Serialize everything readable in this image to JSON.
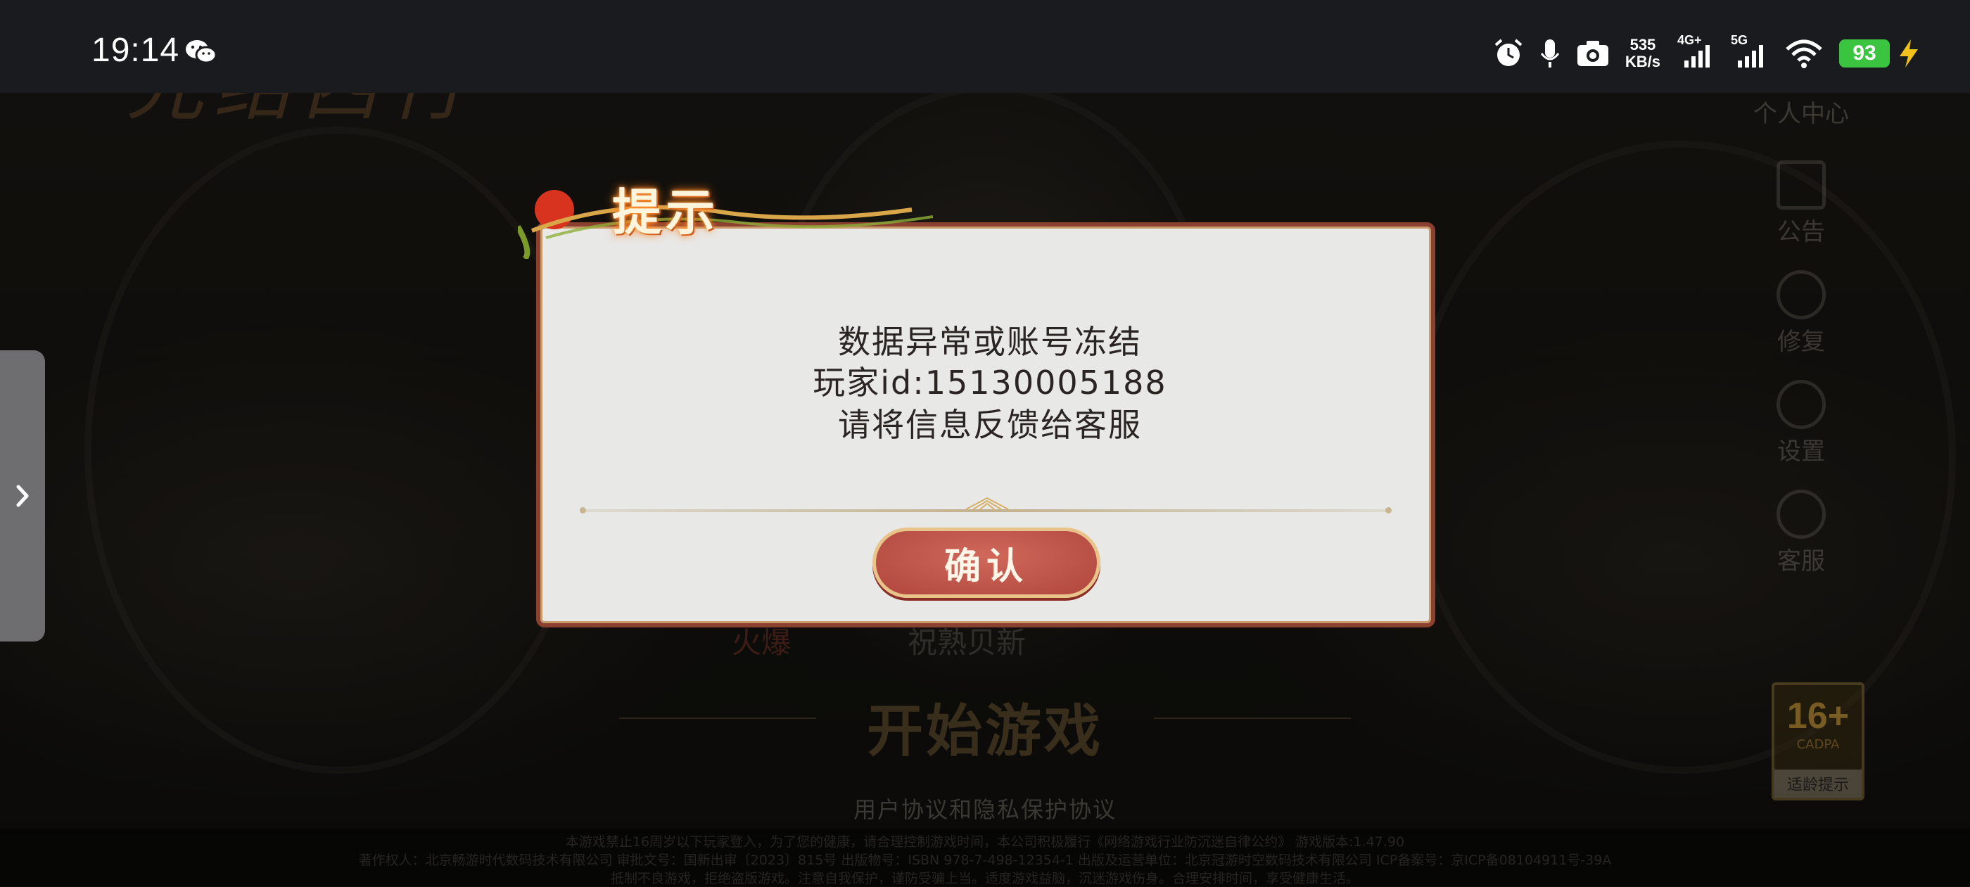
{
  "status_bar": {
    "time": "19:14",
    "speed_value": "535",
    "speed_unit": "KB/s",
    "net1": "4G+",
    "net2": "5G",
    "battery": "93"
  },
  "game": {
    "title": "光结西行",
    "menu": [
      {
        "label": "个人中心",
        "icon": "user-icon"
      },
      {
        "label": "公告",
        "icon": "notice-icon"
      },
      {
        "label": "修复",
        "icon": "repair-icon"
      },
      {
        "label": "设置",
        "icon": "gear-icon"
      },
      {
        "label": "客服",
        "icon": "support-icon"
      }
    ],
    "news_left": "火爆",
    "news_center": "祝熟贝新",
    "start_button": "开始游戏",
    "age_rating": "16+",
    "age_badge_sub": "CADPA",
    "age_tip": "适龄提示",
    "agreement": "用户协议和隐私保护协议",
    "footer_lines": [
      "本游戏禁止16周岁以下玩家登入，为了您的健康，请合理控制游戏时间，本公司积极履行《网络游戏行业防沉迷自律公约》 游戏版本:1.47.90",
      "著作权人：北京畅游时代数码技术有限公司 审批文号：国新出审〔2023〕815号 出版物号：ISBN 978-7-498-12354-1 出版及运营单位：北京冠游时空数码技术有限公司 ICP备案号：京ICP备08104911号-39A",
      "抵制不良游戏，拒绝盗版游戏。注意自我保护，谨防受骗上当。适度游戏益脑，沉迷游戏伤身。合理安排时间，享受健康生活。"
    ]
  },
  "dialog": {
    "title": "提示",
    "line1": "数据异常或账号冻结",
    "line2": "玩家id:15130005188",
    "line3": "请将信息反馈给客服",
    "confirm_label": "确认"
  },
  "colors": {
    "dialog_border": "#8b4030",
    "confirm_bg": "#c0554a",
    "battery_green": "#3bc43f"
  }
}
